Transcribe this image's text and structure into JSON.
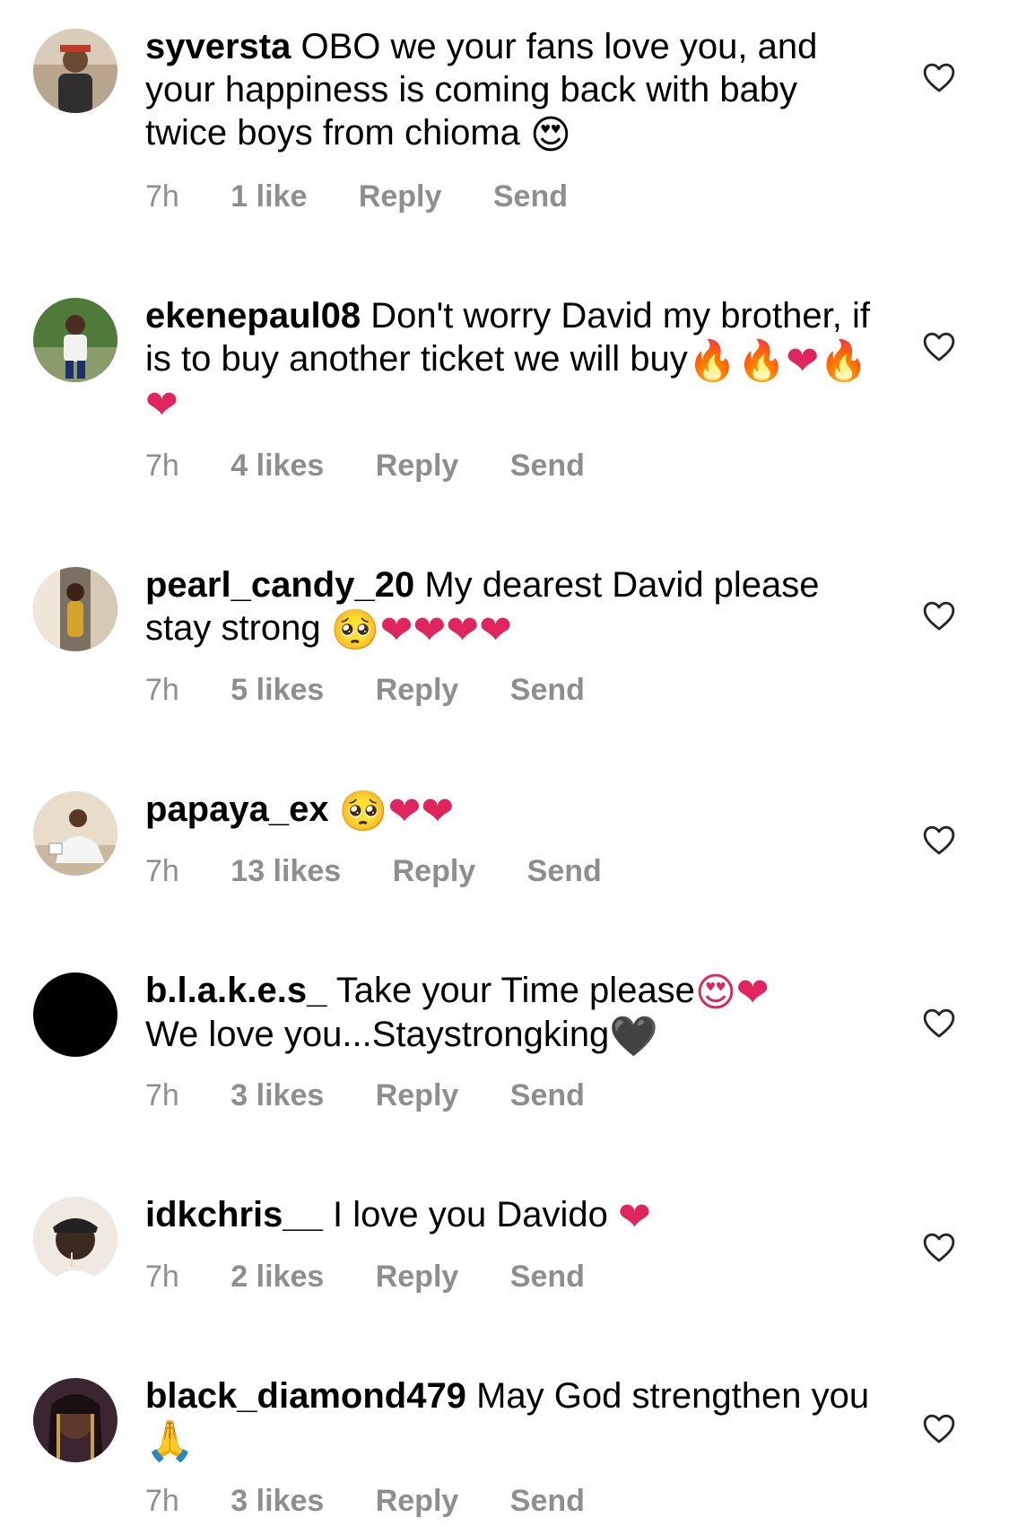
{
  "comments": [
    {
      "username": "syversta",
      "text": "OBO we your fans love you, and your happiness is coming back with baby twice boys from chioma",
      "emoji": "😍",
      "time": "7h",
      "likes": "1 like",
      "reply": "Reply",
      "send": "Send"
    },
    {
      "username": "ekenepaul08",
      "text": "Don't worry David my brother,  if is to buy another ticket we will buy",
      "emoji": "🔥🔥❤🔥❤",
      "time": "7h",
      "likes": "4 likes",
      "reply": "Reply",
      "send": "Send"
    },
    {
      "username": "pearl_candy_20",
      "text": "My dearest David please stay strong",
      "emoji": "🥺❤❤❤❤",
      "time": "7h",
      "likes": "5 likes",
      "reply": "Reply",
      "send": "Send"
    },
    {
      "username": "papaya_ex",
      "text": "",
      "emoji": "🥺❤❤",
      "time": "7h",
      "likes": "13 likes",
      "reply": "Reply",
      "send": "Send"
    },
    {
      "username": "b.l.a.k.e.s_",
      "text": "Take your Time please",
      "emoji": "😍❤",
      "text2": "We love you...Staystrongking",
      "emoji2": "🖤",
      "time": "7h",
      "likes": "3 likes",
      "reply": "Reply",
      "send": "Send"
    },
    {
      "username": "idkchris__",
      "text": "I love you Davido",
      "emoji": "❤",
      "time": "7h",
      "likes": "2 likes",
      "reply": "Reply",
      "send": "Send"
    },
    {
      "username": "black_diamond479",
      "text": "May God strengthen you",
      "emoji": "🙏",
      "time": "7h",
      "likes": "3 likes",
      "reply": "Reply",
      "send": "Send"
    }
  ],
  "icons": {
    "like": "heart-outline-icon"
  },
  "colors": {
    "meta_text": "#8e8e8e",
    "heart_stroke": "#262626"
  }
}
